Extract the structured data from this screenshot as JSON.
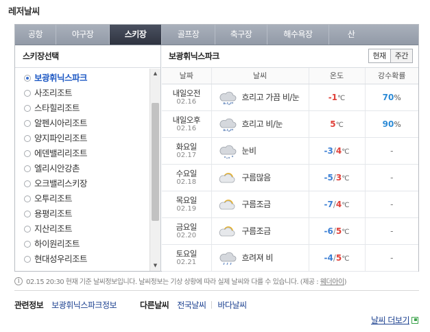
{
  "page_title": "레저날씨",
  "tabs": [
    {
      "label": "공항",
      "active": false
    },
    {
      "label": "야구장",
      "active": false
    },
    {
      "label": "스키장",
      "active": true
    },
    {
      "label": "골프장",
      "active": false
    },
    {
      "label": "축구장",
      "active": false
    },
    {
      "label": "해수욕장",
      "active": false
    },
    {
      "label": "산",
      "active": false
    }
  ],
  "left_panel": {
    "title": "스키장선택",
    "items": [
      {
        "label": "보광휘닉스파크",
        "selected": true
      },
      {
        "label": "사조리조트",
        "selected": false
      },
      {
        "label": "스타힐리조트",
        "selected": false
      },
      {
        "label": "알펜시아리조트",
        "selected": false
      },
      {
        "label": "양지파인리조트",
        "selected": false
      },
      {
        "label": "에덴밸리리조트",
        "selected": false
      },
      {
        "label": "엘리시안강촌",
        "selected": false
      },
      {
        "label": "오크밸리스키장",
        "selected": false
      },
      {
        "label": "오투리조트",
        "selected": false
      },
      {
        "label": "용평리조트",
        "selected": false
      },
      {
        "label": "지산리조트",
        "selected": false
      },
      {
        "label": "하이원리조트",
        "selected": false
      },
      {
        "label": "현대성우리조트",
        "selected": false
      }
    ],
    "scroll_position": 0.38
  },
  "right_panel": {
    "title": "보광휘닉스파크",
    "btn_now": "현재",
    "btn_week": "주간",
    "columns": [
      "날짜",
      "날씨",
      "온도",
      "강수확률"
    ],
    "rows": [
      {
        "day": "내일오전",
        "date": "02.16",
        "icon": "snow-rain-cloud-icon",
        "weather": "흐리고 가끔 비/눈",
        "temp_min": "-1",
        "temp_max": "",
        "rain": "70",
        "rain_unit": "%"
      },
      {
        "day": "내일오후",
        "date": "02.16",
        "icon": "snow-rain-cloud-icon",
        "weather": "흐리고 비/눈",
        "temp_min": "",
        "temp_max": "5",
        "rain": "90",
        "rain_unit": "%"
      },
      {
        "day": "화요일",
        "date": "02.17",
        "icon": "snow-cloud-icon",
        "weather": "눈비",
        "temp_min": "-3",
        "temp_max": "4",
        "rain": "-",
        "rain_unit": ""
      },
      {
        "day": "수요일",
        "date": "02.18",
        "icon": "sun-cloud-icon",
        "weather": "구름많음",
        "temp_min": "-5",
        "temp_max": "3",
        "rain": "-",
        "rain_unit": ""
      },
      {
        "day": "목요일",
        "date": "02.19",
        "icon": "sun-cloud-icon",
        "weather": "구름조금",
        "temp_min": "-7",
        "temp_max": "4",
        "rain": "-",
        "rain_unit": ""
      },
      {
        "day": "금요일",
        "date": "02.20",
        "icon": "sun-cloud-icon",
        "weather": "구름조금",
        "temp_min": "-6",
        "temp_max": "5",
        "rain": "-",
        "rain_unit": ""
      },
      {
        "day": "토요일",
        "date": "02.21",
        "icon": "rain-cloud-icon",
        "weather": "흐려져 비",
        "temp_min": "-4",
        "temp_max": "5",
        "rain": "-",
        "rain_unit": ""
      }
    ],
    "temp_unit": "℃",
    "temp_sep": "/"
  },
  "notice": {
    "text": "02.15 20:30 현재 기준 날씨정보입니다. 날씨정보는 기상 상황에 따라 실제 날씨와 다를 수 있습니다. (제공 : ",
    "provider": "웨더아이",
    "close": ")"
  },
  "related": {
    "label": "관련정보",
    "link": "보광휘닉스파크정보",
    "other_label": "다른날씨",
    "links": [
      "전국날씨",
      "바다날씨"
    ]
  },
  "more_link": "날씨 더보기",
  "colors": {
    "tab_active": "#2f3440",
    "tab_bar": "#9aa1ad",
    "temp_min": "#3b7fd4",
    "temp_max": "#e0413a",
    "rain": "#2d8bd6",
    "link": "#1a3f8f"
  }
}
